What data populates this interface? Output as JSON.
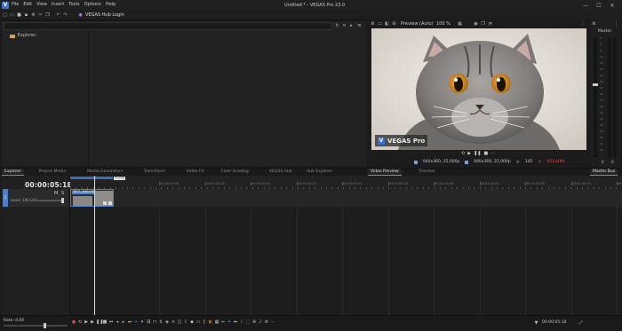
{
  "app": {
    "logo_letter": "V",
    "title": "Untitled * - VEGAS Pro 23.0"
  },
  "menu": [
    "File",
    "Edit",
    "View",
    "Insert",
    "Tools",
    "Options",
    "Help"
  ],
  "hub_login": "VEGAS Hub Login",
  "window_controls": {
    "minimize": "—",
    "maximize": "☐",
    "close": "✕"
  },
  "explorer": {
    "root_label": "Explorer"
  },
  "preview": {
    "mode": "Preview (Auto)",
    "zoom": "100 %",
    "watermark": "VEGAS Pro",
    "info": {
      "project": "640x360, 25,000p",
      "preview_res": "640x360, 25,000p",
      "frame": "145",
      "display": "852x480"
    }
  },
  "master": {
    "label": "Master",
    "values": [
      "0",
      "0"
    ],
    "scale": [
      "3",
      "6",
      "9",
      "12",
      "15",
      "18",
      "21",
      "24",
      "27",
      "30",
      "33",
      "36",
      "39",
      "42",
      "45",
      "48",
      "51",
      "54",
      "57"
    ]
  },
  "tabs_left": [
    "Explorer",
    "Project Media",
    "Media Generators",
    "Transitions",
    "Video FX",
    "Color Grading",
    "VEGAS Hub",
    "Hub Explorer"
  ],
  "tabs_right": [
    "Video Preview",
    "Trimmer"
  ],
  "master_bus": "Master Bus",
  "timecode": "00:00:05:18",
  "timeline_marker": "+1:00",
  "track": {
    "number": "1",
    "level": "Level: 100.0 %",
    "m": "M",
    "s": "S",
    "clip_label": "3871_640x360"
  },
  "ruler": [
    "00:00:00:00",
    "00:00:10:00",
    "00:00:20:00",
    "00:00:30:00",
    "00:00:40:00",
    "00:00:50:00",
    "00:01:00:00",
    "00:01:10:00",
    "00:01:20:00",
    "00:01:30:00",
    "00:01:40:00",
    "00:01:50:00"
  ],
  "status": {
    "rate": "Rate: 0,00",
    "end_time": "00:00:05:18"
  },
  "colors": {
    "accent": "#4a7fd0",
    "clip": "#4d7fc8",
    "badge_red": "#d24a4a"
  }
}
